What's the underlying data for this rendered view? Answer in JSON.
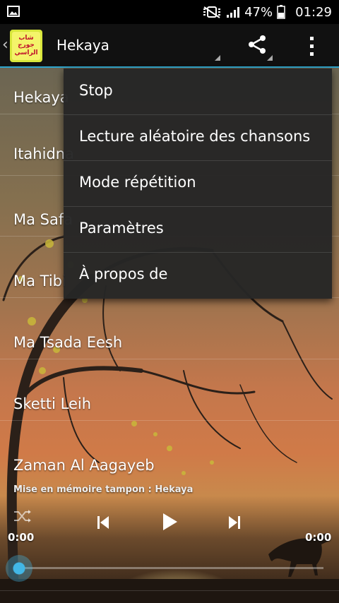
{
  "status_bar": {
    "battery_percent": "47%",
    "time": "01:29",
    "icons": [
      "gallery-notification-icon",
      "mute-vibrate-icon",
      "signal-icon",
      "battery-icon"
    ]
  },
  "action_bar": {
    "title": "Hekaya",
    "icons": [
      "back-chevron-icon",
      "app-logo",
      "share-icon",
      "overflow-menu-icon"
    ]
  },
  "songs": [
    {
      "title": "Hekaya"
    },
    {
      "title": "Itahidna"
    },
    {
      "title": "Ma Safa"
    },
    {
      "title": "Ma Tibi"
    },
    {
      "title": "Ma Tsada Eesh"
    },
    {
      "title": "Sketti Leih"
    },
    {
      "title": "Zaman Al Aagayeb"
    }
  ],
  "menu": {
    "items": [
      {
        "label": "Stop"
      },
      {
        "label": "Lecture aléatoire des chansons"
      },
      {
        "label": "Mode répétition"
      },
      {
        "label": "Paramètres"
      },
      {
        "label": "À propos de"
      }
    ]
  },
  "player": {
    "buffer_status": "Mise en mémoire tampon : Hekaya",
    "current_time": "0:00",
    "total_time": "0:00",
    "progress": 0,
    "controls": [
      "shuffle-icon",
      "previous-icon",
      "play-icon",
      "next-icon"
    ],
    "accent_color": "#42b7e6"
  },
  "colors": {
    "action_bar_bg": "#111111",
    "accent_line": "#2ea6ce",
    "menu_bg": "#262626"
  }
}
